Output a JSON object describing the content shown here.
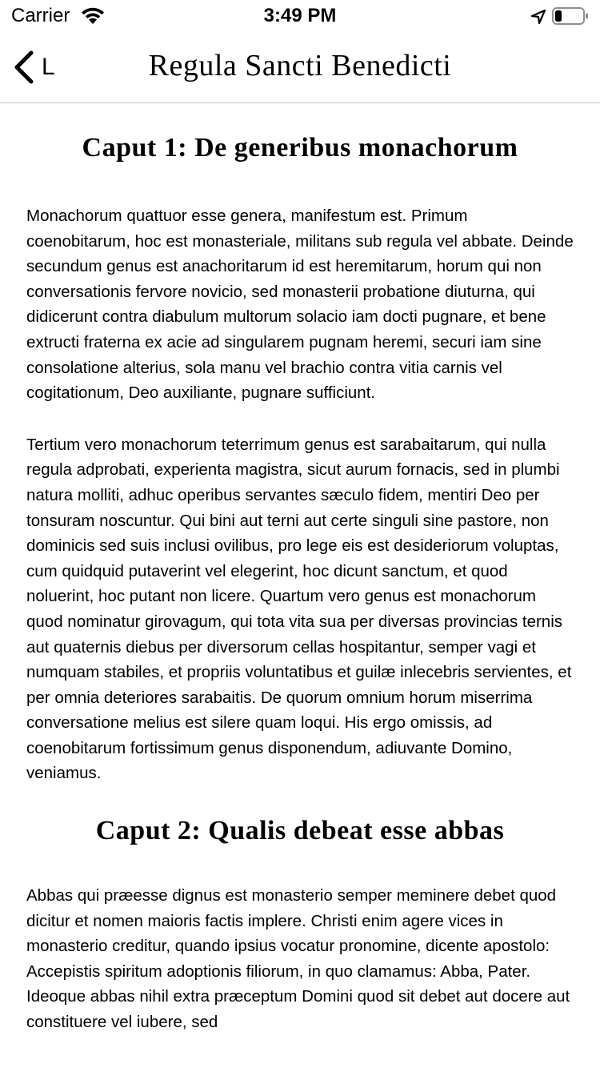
{
  "status_bar": {
    "carrier": "Carrier",
    "time": "3:49 PM",
    "icons": [
      "wifi-icon",
      "location-arrow-icon",
      "battery-icon"
    ]
  },
  "nav": {
    "back_label": "L",
    "back_icon": "chevron-left-icon",
    "title": "Regula Sancti Benedicti"
  },
  "chapters": [
    {
      "title": "Caput 1: De generibus monachorum",
      "paragraphs": [
        "Monachorum quattuor esse genera, manifestum est. Primum coenobitarum, hoc est monasteriale, militans sub regula vel abbate. Deinde secundum genus est anachoritarum id est heremitarum, horum qui non conversationis fervore novicio, sed monasterii probatione diuturna, qui didicerunt contra diabulum multorum solacio iam docti pugnare, et bene extructi fraterna ex acie ad singularem pugnam heremi, securi iam sine consolatione alterius, sola manu vel brachio contra vitia carnis vel cogitationum, Deo auxiliante, pugnare sufficiunt.",
        "Tertium vero monachorum teterrimum genus est sarabaitarum, qui nulla regula adprobati, experienta magistra, sicut aurum fornacis, sed in plumbi natura molliti, adhuc operibus servantes sæculo fidem, mentiri Deo per tonsuram noscuntur. Qui bini aut terni aut certe singuli sine pastore, non dominicis sed suis inclusi ovilibus, pro lege eis est desideriorum voluptas, cum quidquid putaverint vel elegerint, hoc dicunt sanctum, et quod noluerint, hoc putant non licere. Quartum vero genus est monachorum quod nominatur girovagum, qui tota vita sua per diversas provincias ternis aut quaternis diebus per diversorum cellas hospitantur, semper vagi et numquam stabiles, et propriis voluntatibus et guilæ inlecebris servientes, et per omnia deteriores sarabaitis. De quorum omnium horum miserrima conversatione melius est silere quam loqui. His ergo omissis, ad coenobitarum fortissimum genus disponendum, adiuvante Domino, veniamus."
      ]
    },
    {
      "title": "Caput 2: Qualis debeat esse abbas",
      "paragraphs": [
        "Abbas qui præesse dignus est monasterio semper meminere debet quod dicitur et nomen maioris factis implere. Christi enim agere vices in monasterio creditur, quando ipsius vocatur pronomine, dicente apostolo: Accepistis spiritum adoptionis filiorum, in quo clamamus: Abba, Pater. Ideoque abbas nihil extra præceptum Domini quod sit debet aut docere aut constituere vel iubere, sed"
      ]
    }
  ]
}
